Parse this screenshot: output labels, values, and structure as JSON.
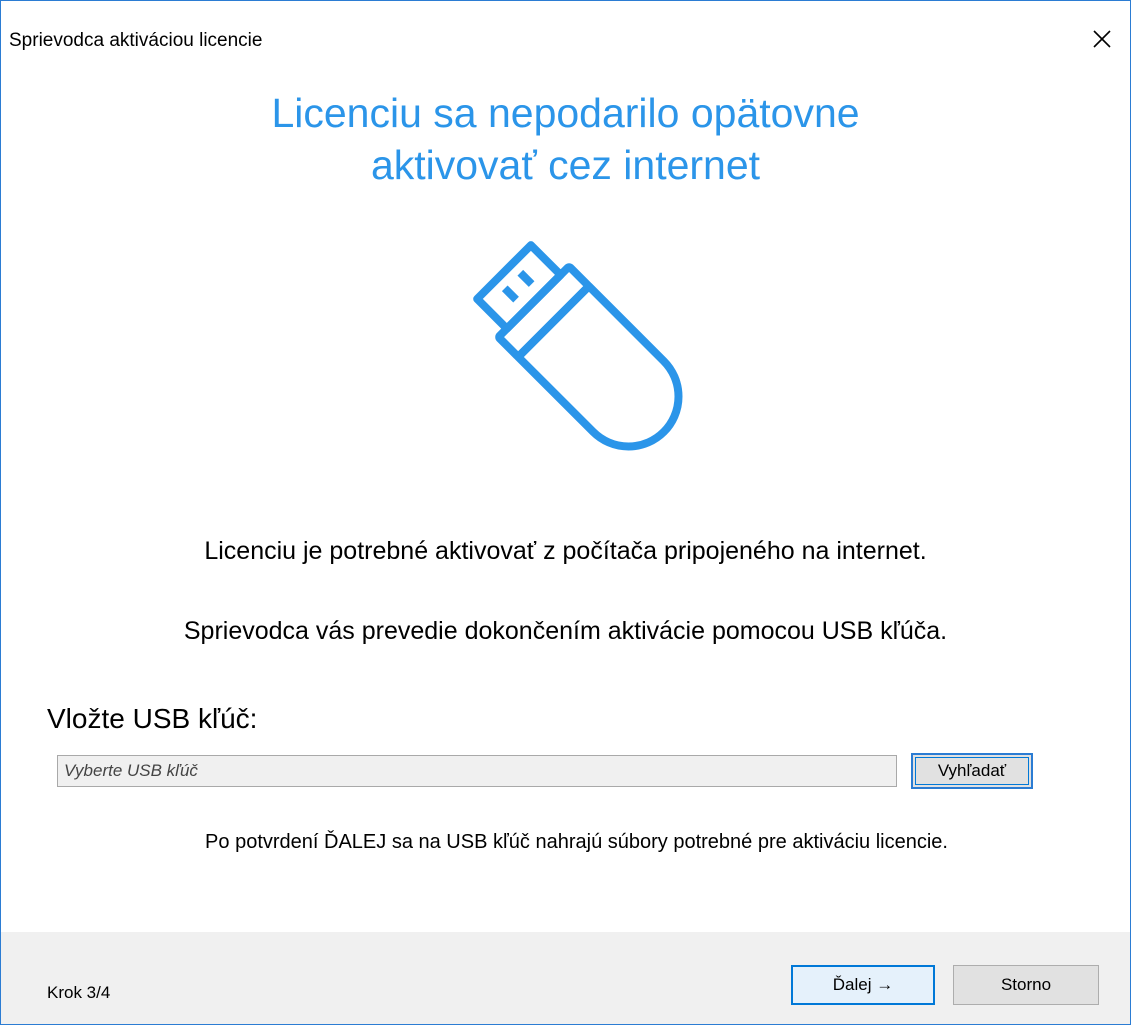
{
  "window": {
    "title": "Sprievodca aktiváciou licencie",
    "close_icon": "close-icon"
  },
  "headline": {
    "line1": "Licenciu sa nepodarilo opätovne",
    "line2": "aktivovať cez internet"
  },
  "illustration": {
    "icon": "usb-drive-icon",
    "color": "#2b95e9"
  },
  "description": {
    "line1": "Licenciu je potrebné aktivovať z počítača pripojeného na internet.",
    "line2": "Sprievodca vás prevedie dokončením aktivácie pomocou USB kľúča."
  },
  "usb_selector": {
    "label": "Vložte USB kľúč:",
    "placeholder": "Vyberte USB kľúč",
    "value": "",
    "search_button": "Vyhľadať"
  },
  "note": "Po potvrdení ĎALEJ sa na USB kľúč nahrajú súbory potrebné pre aktiváciu licencie.",
  "footer": {
    "step": "Krok 3/4",
    "next_button": "Ďalej →",
    "cancel_button": "Storno"
  },
  "colors": {
    "accent": "#2b95e9",
    "border": "#2b7cd3",
    "footer_bg": "#f0f0f0"
  }
}
